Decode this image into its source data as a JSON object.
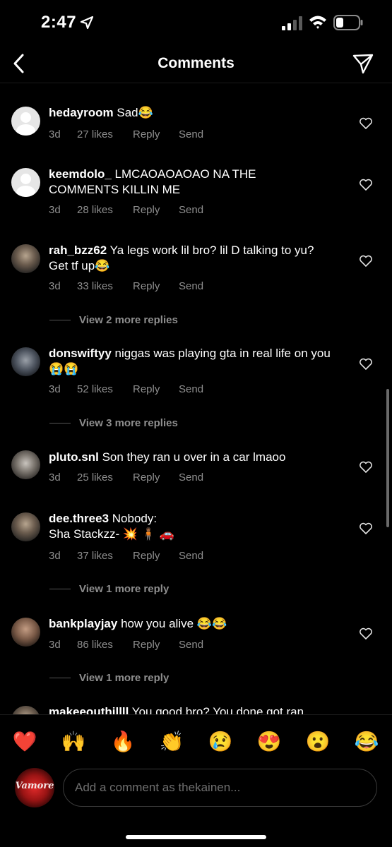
{
  "status_bar": {
    "time": "2:47",
    "location_icon": "location-arrow-icon",
    "signal_icon": "cellular-signal-icon",
    "wifi_icon": "wifi-icon",
    "battery_icon": "battery-icon"
  },
  "nav": {
    "title": "Comments",
    "back_icon": "chevron-left-icon",
    "share_icon": "paper-plane-icon"
  },
  "comments": [
    {
      "username": "hedayroom",
      "text": "Sad😂",
      "time": "3d",
      "likes": "27 likes",
      "reply": "Reply",
      "send": "Send",
      "avatar": "default-avatar"
    },
    {
      "username": "keemdolo_",
      "text": "LMCAOAOAOAO NA THE COMMENTS KILLIN ME",
      "time": "3d",
      "likes": "28 likes",
      "reply": "Reply",
      "send": "Send",
      "avatar": "default-avatar"
    },
    {
      "username": "rah_bzz62",
      "text": "Ya legs work lil bro? lil D talking to yu? Get tf up😂",
      "time": "3d",
      "likes": "33 likes",
      "reply": "Reply",
      "send": "Send",
      "avatar": "photo",
      "view_replies": "View 2 more replies"
    },
    {
      "username": "donswiftyy",
      "text": "niggas was playing gta in real life on you😭😭",
      "time": "3d",
      "likes": "52 likes",
      "reply": "Reply",
      "send": "Send",
      "avatar": "photo",
      "view_replies": "View 3 more replies"
    },
    {
      "username": "pluto.snl",
      "text": "Son they ran u over in a car lmaoo",
      "time": "3d",
      "likes": "25 likes",
      "reply": "Reply",
      "send": "Send",
      "avatar": "photo"
    },
    {
      "username": "dee.three3",
      "text": "Nobody:",
      "text2": "Sha Stackzz-  💥 🧍🏾 🚗",
      "time": "3d",
      "likes": "37 likes",
      "reply": "Reply",
      "send": "Send",
      "avatar": "photo",
      "view_replies": "View 1 more reply"
    },
    {
      "username": "bankplayjay",
      "text": "how you alive 😂😂",
      "time": "3d",
      "likes": "86 likes",
      "reply": "Reply",
      "send": "Send",
      "avatar": "photo",
      "view_replies": "View 1 more reply"
    },
    {
      "username": "makeeouthillll",
      "text": "You good bro? You done got ran",
      "avatar": "photo"
    }
  ],
  "emoji_bar": [
    "❤️",
    "🙌",
    "🔥",
    "👏",
    "😢",
    "😍",
    "😮",
    "😂"
  ],
  "composer": {
    "placeholder": "Add a comment as thekainen...",
    "avatar_text": "Vamore"
  },
  "colors": {
    "background": "#000000",
    "text": "#ffffff",
    "secondary_text": "#8e8e8e",
    "input_border": "#3a3a3a"
  }
}
